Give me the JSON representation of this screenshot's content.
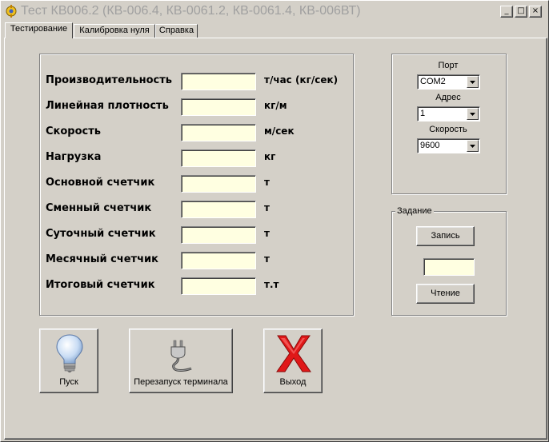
{
  "window": {
    "title": "Тест КВ006.2 (КВ-006.4, КВ-0061.2, КВ-0061.4, КВ-006ВТ)",
    "controls": {
      "minimize": "_",
      "maximize": "□",
      "close": "×"
    }
  },
  "tabs": [
    {
      "label": "Тестирование",
      "active": true
    },
    {
      "label": "Калибровка нуля",
      "active": false
    },
    {
      "label": "Справка",
      "active": false
    }
  ],
  "readings": [
    {
      "label": "Производительность",
      "value": "",
      "unit": "т/час (кг/сек)"
    },
    {
      "label": "Линейная плотность",
      "value": "",
      "unit": "кг/м"
    },
    {
      "label": "Скорость",
      "value": "",
      "unit": "м/сек"
    },
    {
      "label": "Нагрузка",
      "value": "",
      "unit": "кг"
    },
    {
      "label": "Основной счетчик",
      "value": "",
      "unit": "т"
    },
    {
      "label": "Сменный счетчик",
      "value": "",
      "unit": "т"
    },
    {
      "label": "Суточный счетчик",
      "value": "",
      "unit": "т"
    },
    {
      "label": "Месячный счетчик",
      "value": "",
      "unit": "т"
    },
    {
      "label": "Итоговый счетчик",
      "value": "",
      "unit": "т.т"
    }
  ],
  "connection": {
    "port_label": "Порт",
    "port_value": "COM2",
    "address_label": "Адрес",
    "address_value": "1",
    "speed_label": "Скорость",
    "speed_value": "9600"
  },
  "task": {
    "legend": "Задание",
    "write_label": "Запись",
    "value": "",
    "read_label": "Чтение"
  },
  "actions": {
    "start_label": "Пуск",
    "restart_label": "Перезапуск терминала",
    "exit_label": "Выход"
  },
  "colors": {
    "face": "#d4d0c8",
    "field_bg": "#ffffe1",
    "exit_icon": "#e01818"
  },
  "icons": [
    "app-icon",
    "lightbulb-icon",
    "plug-icon",
    "red-x-icon",
    "chevron-down-icon"
  ]
}
